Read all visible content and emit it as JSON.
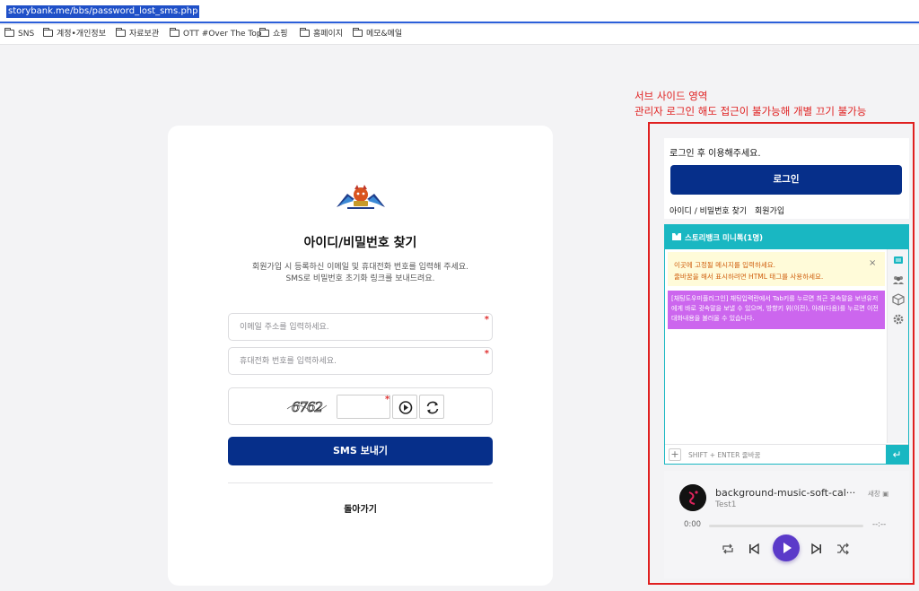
{
  "browser": {
    "url": "storybank.me/bbs/password_lost_sms.php",
    "bookmarks": [
      {
        "label": "SNS",
        "icon": "folder-icon"
      },
      {
        "label": "계정•개인정보",
        "icon": "folder-icon"
      },
      {
        "label": "자료보관",
        "icon": "folder-icon"
      },
      {
        "label": "OTT #Over The Top",
        "icon": "folder-icon"
      },
      {
        "label": "쇼핑",
        "icon": "folder-icon"
      },
      {
        "label": "홈페이지",
        "icon": "folder-icon"
      },
      {
        "label": "메모&메일",
        "icon": "folder-icon"
      }
    ]
  },
  "form": {
    "logo_icon": "site-logo-icon",
    "title": "아이디/비밀번호 찾기",
    "description_line1": "회원가입 시 등록하신 이메일 및 휴대전화 번호를 입력해 주세요.",
    "description_line2": "SMS로 비밀번호 초기화 링크를 보내드려요.",
    "email_placeholder": "이메일 주소를 입력하세요.",
    "phone_placeholder": "휴대전화 번호를 입력하세요.",
    "required_mark": "*",
    "captcha_text": "6762",
    "submit_label": "SMS 보내기",
    "back_label": "돌아가기"
  },
  "annotation": {
    "line1": "서브 사이드 영역",
    "line2": "관리자 로그인 해도 접근이 불가능해 개별 끄기 불가능",
    "color": "#e02020"
  },
  "sidebar": {
    "login_message": "로그인 후 이용해주세요.",
    "login_button": "로그인",
    "find_link": "아이디 / 비밀번호 찾기",
    "join_link": "회원가입",
    "accent": "#062f8a"
  },
  "chat": {
    "title": "스토리뱅크 미니톡(1명)",
    "notice_line1": "이곳에 고정될 메시지를 입력하세요.",
    "notice_line2": "줄바꿈을 해서 표시하려면 HTML 태그를 사용하세요.",
    "notice_close": "×",
    "tip": "[채팅도우미플러그인] 채팅입력란에서 Tab키를 누르면 최근 귓속말을 보낸유저에게 바로 귓속말을 보낼 수 있으며, 방향키 위(이전), 아래(다음)를 누르면 이전 대화내용을 불러올 수 있습니다.",
    "input_placeholder": "SHIFT + ENTER 줄바꿈",
    "plus_label": "+",
    "send_label": "↵",
    "accent": "#19b7c2",
    "side_tabs": [
      "chat-icon",
      "users-icon",
      "box-icon",
      "gear-icon"
    ]
  },
  "player": {
    "title": "background-music-soft-cal···",
    "artist": "Test1",
    "tag": "새창",
    "time_current": "0:00",
    "time_total": "--:--",
    "progress": 0,
    "accent": "#5b3ac9"
  }
}
